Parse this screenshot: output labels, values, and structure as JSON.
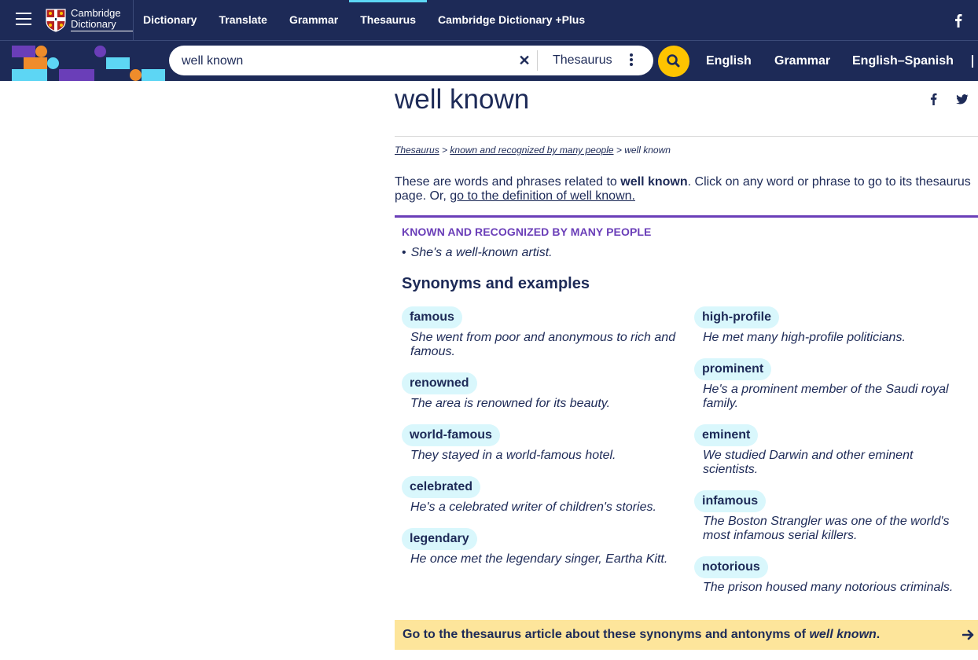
{
  "header": {
    "logo_line1": "Cambridge",
    "logo_line2": "Dictionary",
    "nav": [
      "Dictionary",
      "Translate",
      "Grammar",
      "Thesaurus",
      "Cambridge Dictionary +Plus"
    ],
    "active_nav": "Thesaurus",
    "social_icon": "facebook-icon"
  },
  "search": {
    "value": "well known",
    "dictionary_selected": "Thesaurus",
    "quick_links": [
      "English",
      "Grammar",
      "English–Spanish"
    ]
  },
  "colors": {
    "navy": "#1d2a57",
    "purple": "#6a3eb8",
    "cyan": "#5dd6f4",
    "yellow": "#fec400",
    "pill": "#d9f7fc",
    "banner": "#fde59b",
    "orange": "#ef8c2b"
  },
  "page": {
    "title": "well known",
    "breadcrumb": {
      "link1": "Thesaurus",
      "sep": " > ",
      "link2": "known and recognized by many people",
      "current": "well known"
    },
    "intro": {
      "before": "These are words and phrases related to ",
      "term": "well known",
      "after": ". Click on any word or phrase to go to its thesaurus page. Or, ",
      "link": "go to the definition of well known."
    },
    "sense": {
      "title": "KNOWN AND RECOGNIZED BY MANY PEOPLE",
      "example": "She's a well-known artist.",
      "bullet": "•"
    },
    "synonyms_heading": "Synonyms and examples",
    "synonyms_left": [
      {
        "word": "famous",
        "example": "She went from poor and anonymous to rich and famous."
      },
      {
        "word": "renowned",
        "example": "The area is renowned for its beauty."
      },
      {
        "word": "world-famous",
        "example": "They stayed in a world-famous hotel."
      },
      {
        "word": "celebrated",
        "example": "He's a celebrated writer of children's stories."
      },
      {
        "word": "legendary",
        "example": "He once met the legendary singer, Eartha Kitt."
      }
    ],
    "synonyms_right": [
      {
        "word": "high-profile",
        "example": "He met many high-profile politicians."
      },
      {
        "word": "prominent",
        "example": "He's a prominent member of the Saudi royal family."
      },
      {
        "word": "eminent",
        "example": "We studied Darwin and other eminent scientists."
      },
      {
        "word": "infamous",
        "example": "The Boston Strangler was one of the world's most infamous serial killers."
      },
      {
        "word": "notorious",
        "example": "The prison housed many notorious criminals."
      }
    ],
    "bottom_banner": {
      "text": "Go to the thesaurus article about these synonyms and antonyms of ",
      "term": "well known",
      "end": "."
    }
  }
}
